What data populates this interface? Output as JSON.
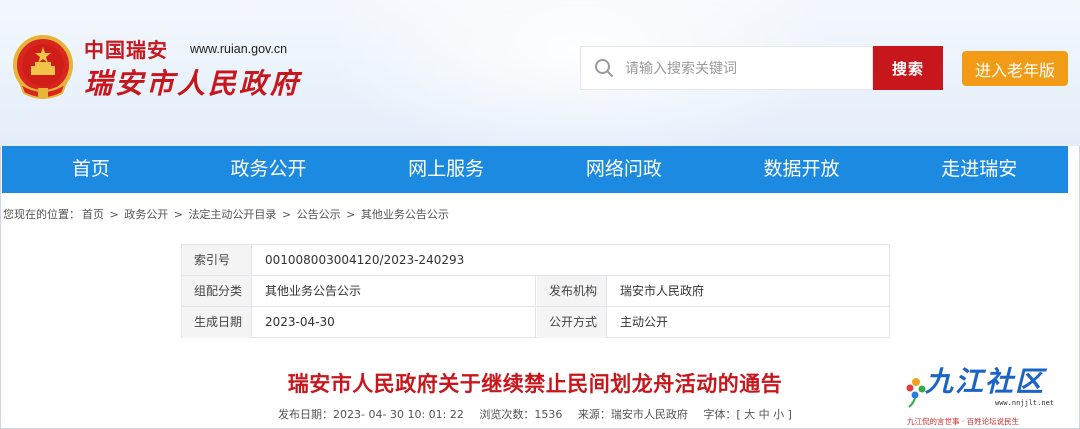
{
  "site": {
    "title_line1": "中国瑞安",
    "url": "www.ruian.gov.cn",
    "title_line2": "瑞安市人民政府"
  },
  "search": {
    "placeholder": "请输入搜索关键词",
    "button_label": "搜索"
  },
  "elder_button": "进入老年版",
  "nav": [
    "首页",
    "政务公开",
    "网上服务",
    "网络问政",
    "数据开放",
    "走进瑞安"
  ],
  "breadcrumb": {
    "prefix": "您现在的位置：",
    "items": [
      "首页",
      "政务公开",
      "法定主动公开目录",
      "公告公示",
      "其他业务公告公示"
    ],
    "separator": ">"
  },
  "info": {
    "index_label": "索引号",
    "index_value": "001008003004120/2023-240293",
    "category_label": "组配分类",
    "category_value": "其他业务公告公示",
    "publisher_label": "发布机构",
    "publisher_value": "瑞安市人民政府",
    "date_label": "生成日期",
    "date_value": "2023-04-30",
    "method_label": "公开方式",
    "method_value": "主动公开"
  },
  "article": {
    "title": "瑞安市人民政府关于继续禁止民间划龙舟活动的通告",
    "publish_date": "发布日期：2023- 04- 30 10: 01: 22",
    "views": "浏览次数：1536",
    "source": "来源：瑞安市人民政府",
    "font_size": "字体：[ 大 中 小 ]"
  },
  "watermark": {
    "title": "九江社区",
    "url": "www.nnjjlt.net",
    "slogan": "九江侃的言世事 · 百姓论坛说民生"
  },
  "colors": {
    "brand_red": "#c8161d",
    "nav_blue": "#1c8ae0",
    "elder_orange": "#f29b17"
  }
}
